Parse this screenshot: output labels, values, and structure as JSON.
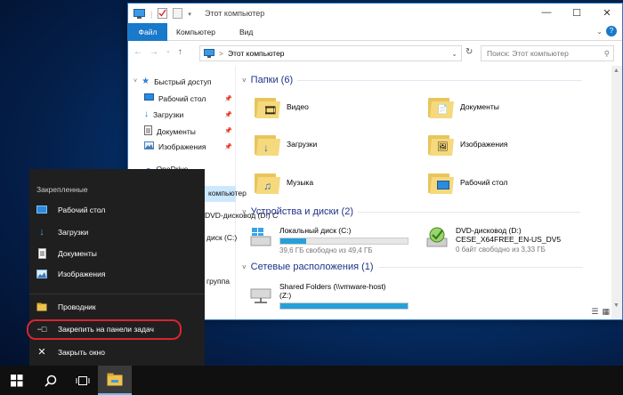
{
  "window": {
    "title": "Этот компьютер",
    "tabs": {
      "file": "Файл",
      "computer": "Компьютер",
      "view": "Вид"
    },
    "address": "Этот компьютер",
    "search_placeholder": "Поиск: Этот компьютер"
  },
  "nav": {
    "quick_access": "Быстрый доступ",
    "items": [
      "Рабочий стол",
      "Загрузки",
      "Документы",
      "Изображения"
    ],
    "partial": [
      "OneDrive",
      "компьютер",
      "DVD-дисковод (D:) C",
      "диск (C:)",
      "группа"
    ]
  },
  "content": {
    "folders_header": "Папки (6)",
    "folders": [
      "Видео",
      "Документы",
      "Загрузки",
      "Изображения",
      "Музыка",
      "Рабочий стол"
    ],
    "devices_header": "Устройства и диски (2)",
    "drives": [
      {
        "name": "Локальный диск (C:)",
        "detail": "39,6 ГБ свободно из 49,4 ГБ",
        "used_percent": 20
      },
      {
        "name": "DVD-дисковод (D:)",
        "label": "CESE_X64FREE_EN-US_DV5",
        "detail": "0 байт свободно из 3,33 ГБ"
      }
    ],
    "network_header": "Сетевые расположения (1)",
    "network": {
      "name": "Shared Folders (\\\\vmware-host)",
      "letter": "(Z:)"
    }
  },
  "jumplist": {
    "header": "Закрепленные",
    "pinned": [
      "Рабочий стол",
      "Загрузки",
      "Документы",
      "Изображения"
    ],
    "actions": [
      "Проводник",
      "Закрепить на панели задач",
      "Закрыть окно"
    ]
  },
  "colors": {
    "accent": "#1979ca",
    "highlight": "#d8252f",
    "taskbar": "#101010"
  }
}
